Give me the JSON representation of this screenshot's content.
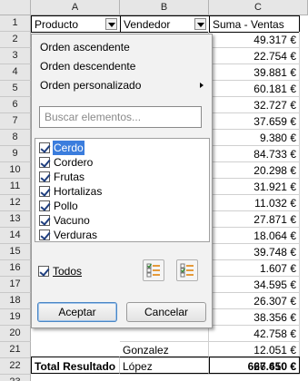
{
  "columns": [
    {
      "label": "A"
    },
    {
      "label": "B"
    },
    {
      "label": "C"
    }
  ],
  "rows": [
    {
      "num": "1",
      "a": "Producto",
      "b": "Vendedor",
      "c": "Suma - Ventas"
    },
    {
      "num": "2",
      "a": "",
      "b": "",
      "c": "49.317 €"
    },
    {
      "num": "3",
      "a": "",
      "b": "",
      "c": "22.754 €"
    },
    {
      "num": "4",
      "a": "",
      "b": "",
      "c": "39.881 €"
    },
    {
      "num": "5",
      "a": "",
      "b": "",
      "c": "60.181 €"
    },
    {
      "num": "6",
      "a": "",
      "b": "",
      "c": "32.727 €"
    },
    {
      "num": "7",
      "a": "",
      "b": "",
      "c": "37.659 €"
    },
    {
      "num": "8",
      "a": "",
      "b": "",
      "c": "9.380 €"
    },
    {
      "num": "9",
      "a": "",
      "b": "",
      "c": "84.733 €"
    },
    {
      "num": "10",
      "a": "",
      "b": "",
      "c": "20.298 €"
    },
    {
      "num": "11",
      "a": "",
      "b": "",
      "c": "31.921 €"
    },
    {
      "num": "12",
      "a": "",
      "b": "",
      "c": "11.032 €"
    },
    {
      "num": "13",
      "a": "",
      "b": "",
      "c": "27.871 €"
    },
    {
      "num": "14",
      "a": "",
      "b": "",
      "c": "18.064 €"
    },
    {
      "num": "15",
      "a": "",
      "b": "",
      "c": "39.748 €"
    },
    {
      "num": "16",
      "a": "",
      "b": "",
      "c": "1.607 €"
    },
    {
      "num": "17",
      "a": "",
      "b": "",
      "c": "34.595 €"
    },
    {
      "num": "18",
      "a": "",
      "b": "",
      "c": "26.307 €"
    },
    {
      "num": "19",
      "a": "",
      "b": "",
      "c": "38.356 €"
    },
    {
      "num": "20",
      "a": "",
      "b": "",
      "c": "42.758 €"
    },
    {
      "num": "21",
      "a": "",
      "b": "Gonzalez",
      "c": "12.051 €"
    },
    {
      "num": "22",
      "a": "",
      "b": "López",
      "c": "26.410 €"
    },
    {
      "num": "23",
      "a": "Total Resultado",
      "b": "",
      "c": "667.650 €"
    }
  ],
  "popup": {
    "sort_asc": "Orden ascendente",
    "sort_desc": "Orden descendente",
    "sort_custom": "Orden personalizado",
    "search_placeholder": "Buscar elementos...",
    "items": [
      {
        "label": "Cerdo",
        "checked": true,
        "selected": true
      },
      {
        "label": "Cordero",
        "checked": true
      },
      {
        "label": "Frutas",
        "checked": true
      },
      {
        "label": "Hortalizas",
        "checked": true
      },
      {
        "label": "Pollo",
        "checked": true
      },
      {
        "label": "Vacuno",
        "checked": true
      },
      {
        "label": "Verduras",
        "checked": true
      }
    ],
    "all_label": "Todos",
    "all_checked": true,
    "ok_label": "Aceptar",
    "cancel_label": "Cancelar"
  },
  "colors": {
    "selection": "#3b7ddd",
    "header_bg": "#e6e6e6",
    "popup_bg": "#f2f2f2",
    "check": "#1f3f7f"
  }
}
